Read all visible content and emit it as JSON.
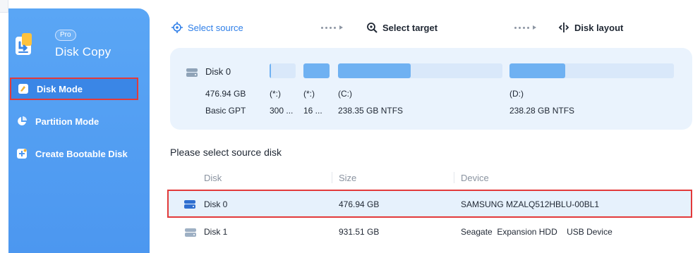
{
  "app": {
    "badge": "Pro",
    "title": "Disk Copy",
    "accent": "#4c97f0",
    "highlight": "#e23a3a"
  },
  "sidebar": {
    "items": [
      {
        "label": "Disk Mode",
        "icon": "disk-mode-icon",
        "active": true
      },
      {
        "label": "Partition Mode",
        "icon": "pie-chart-icon",
        "active": false
      },
      {
        "label": "Create Bootable Disk",
        "icon": "bootable-disk-icon",
        "active": false
      }
    ]
  },
  "steps": [
    {
      "label": "Select source",
      "icon": "crosshair-icon"
    },
    {
      "label": "Select target",
      "icon": "target-search-icon"
    },
    {
      "label": "Disk layout",
      "icon": "split-arrows-icon"
    }
  ],
  "disk_map": {
    "name": "Disk 0",
    "size": "476.94 GB",
    "type": "Basic GPT",
    "partitions": [
      {
        "letter": "(*:)",
        "info": "300 ...",
        "used": 0.06
      },
      {
        "letter": "(*:)",
        "info": "16 ...",
        "used": 1.0
      },
      {
        "letter": "(C:)",
        "info": "238.35 GB NTFS",
        "used": 0.44
      },
      {
        "letter": "(D:)",
        "info": "238.28 GB NTFS",
        "used": 0.34
      }
    ]
  },
  "table": {
    "section_title": "Please select source disk",
    "columns": [
      "Disk",
      "Size",
      "Device"
    ],
    "rows": [
      {
        "disk": "Disk 0",
        "size": "476.94 GB",
        "device": "SAMSUNG MZALQ512HBLU-00BL1",
        "selected": true
      },
      {
        "disk": "Disk 1",
        "size": "931.51 GB",
        "device": "Seagate  Expansion HDD    USB Device",
        "selected": false
      }
    ]
  }
}
